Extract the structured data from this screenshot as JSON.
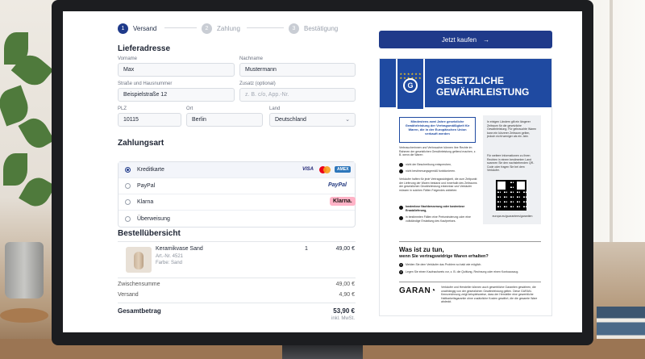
{
  "steps": [
    {
      "num": "1",
      "label": "Versand"
    },
    {
      "num": "2",
      "label": "Zahlung"
    },
    {
      "num": "3",
      "label": "Bestätigung"
    }
  ],
  "address": {
    "title": "Lieferadresse",
    "firstname_label": "Vorname",
    "firstname": "Max",
    "lastname_label": "Nachname",
    "lastname": "Mustermann",
    "street_label": "Straße und Hausnummer",
    "street": "Beispielstraße 12",
    "extra_label": "Zusatz (optional)",
    "extra_placeholder": "z. B. c/o, App.-Nr.",
    "zip_label": "PLZ",
    "zip": "10115",
    "city_label": "Ort",
    "city": "Berlin",
    "country_label": "Land",
    "country": "Deutschland"
  },
  "payment": {
    "title": "Zahlungsart",
    "options": [
      {
        "label": "Kreditkarte",
        "selected": true
      },
      {
        "label": "PayPal",
        "selected": false
      },
      {
        "label": "Klarna",
        "selected": false
      },
      {
        "label": "Überweisung",
        "selected": false
      }
    ],
    "brands": {
      "visa": "VISA",
      "amex": "AMEX",
      "paypal": "PayPal",
      "klarna": "Klarna."
    }
  },
  "order": {
    "title": "Bestellübersicht",
    "item_name": "Keramikvase Sand",
    "item_sku": "Art.-Nr. 4521",
    "item_color": "Farbe: Sand",
    "item_qty": "1",
    "item_price": "49,00 €",
    "subtotal_label": "Zwischensumme",
    "subtotal": "49,00 €",
    "shipping_label": "Versand",
    "shipping": "4,90 €",
    "total_label": "Gesamtbetrag",
    "total": "53,90 €",
    "vat_note": "inkl. MwSt."
  },
  "buy_button": {
    "label": "Jetzt kaufen",
    "arrow": "→"
  },
  "poster": {
    "title_line1": "GESETZLICHE",
    "title_line2": "GEWÄHRLEISTUNG",
    "badge_letter": "G",
    "badge_stars": "★ ★ ★ ★ ★ ★ ★ ★ ★ ★ ★ ★",
    "blue_box": "Mindestens zwei Jahre gesetzliche Gewährleistung der Vertragsmäßigkeit für Waren, die in der Europäischen Union verkauft werden",
    "intro": "Verbraucherinnen und Verbraucher können ihre Rechte im Rahmen der gesetzlichen Gewährleistung geltend machen, z. B. wenn die Waren",
    "check1": "nicht der Beschreibung entsprechen,",
    "check2": "nicht bestimmungsgemäß funktionieren.",
    "seller_text": "Verkäufer haften für jede Vertragswidrigkeit, die zum Zeitpunkt der Lieferung der Waren bestand und innerhalb des Zeitraums der gesetzlichen Gewährleistung erkennbar und Verkäufer müssen in solchen Fällen Folgendes anbieten:",
    "check3": "kostenlose Nachbesserung oder kostenlose Ersatzlieferung,",
    "check4": "in bestimmten Fällen eine Preisminderung oder eine vollständige Erstattung des Kaufpreises.",
    "grey_text": "In einigen Ländern gilt ein längerer Zeitraum für die gesetzliche Gewährleistung. Für gebrauchte Waren kann ein kürzerer Zeitraum gelten, jedoch nicht weniger als ein Jahr.",
    "grey_text2": "Für weitere Informationen zu Ihren Rechten in einem bestimmten Land scannen Sie den nachstehenden QR-Code oder fragen Sie bei dem Verkäufer.",
    "qr_caption": "europa.eu/guarantees/garantien",
    "question": "Was ist zu tun,",
    "question_sub": "wenn Sie vertragswidrige Waren erhalten?",
    "step1": "Melden Sie dem Verkäufer das Problem so bald wie möglich.",
    "step2": "Legen Sie einen Kaufnachweis vor, z. B. die Quittung, Rechnung oder einen Kontoauszug.",
    "step1_num": "1",
    "step2_num": "2",
    "garan": "GARAN◔",
    "garan_text": "Verkäufer und Hersteller können auch gewerbliche Garantien gewähren, die unabhängig von der gesetzlichen Gewährleistung gelten. Diese GARAN-Kennzeichnung zeigt beispielsweise, dass der Hersteller eine gewerbliche Haltbarkeitsgarantie ohne zusätzliche Kosten gewährt, die die gesamte Ware abdeckt."
  },
  "colors": {
    "primary": "#1f3a8a",
    "poster_blue": "#1f4aa1"
  }
}
